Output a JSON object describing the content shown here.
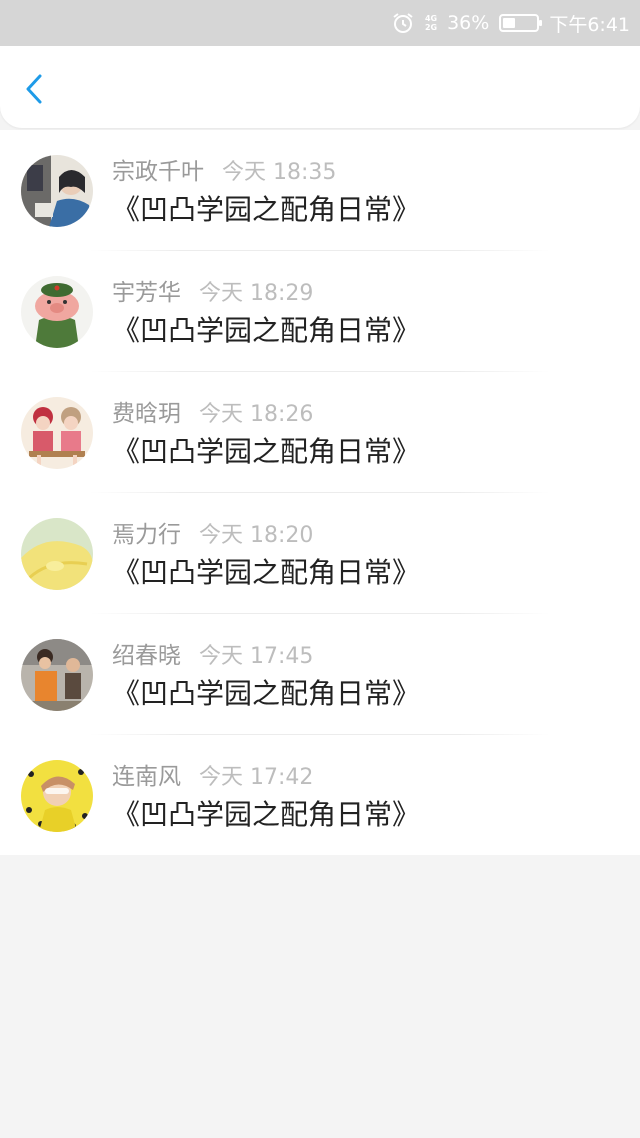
{
  "status_bar": {
    "network_top": "4G",
    "network_bottom": "2G",
    "battery": "36%",
    "battery_level": 0.36,
    "time": "下午6:41"
  },
  "nav": {
    "back_icon": "chevron-left-icon",
    "accent": "#1e9be8"
  },
  "comments": [
    {
      "name": "宗政千叶",
      "time": "今天 18:35",
      "message": "《凹凸学园之配角日常》"
    },
    {
      "name": "宇芳华",
      "time": "今天 18:29",
      "message": "《凹凸学园之配角日常》"
    },
    {
      "name": "费晗玥",
      "time": "今天 18:26",
      "message": "《凹凸学园之配角日常》"
    },
    {
      "name": "焉力行",
      "time": "今天 18:20",
      "message": "《凹凸学园之配角日常》"
    },
    {
      "name": "绍春晓",
      "time": "今天 17:45",
      "message": "《凹凸学园之配角日常》"
    },
    {
      "name": "连南风",
      "time": "今天 17:42",
      "message": "《凹凸学园之配角日常》"
    }
  ]
}
